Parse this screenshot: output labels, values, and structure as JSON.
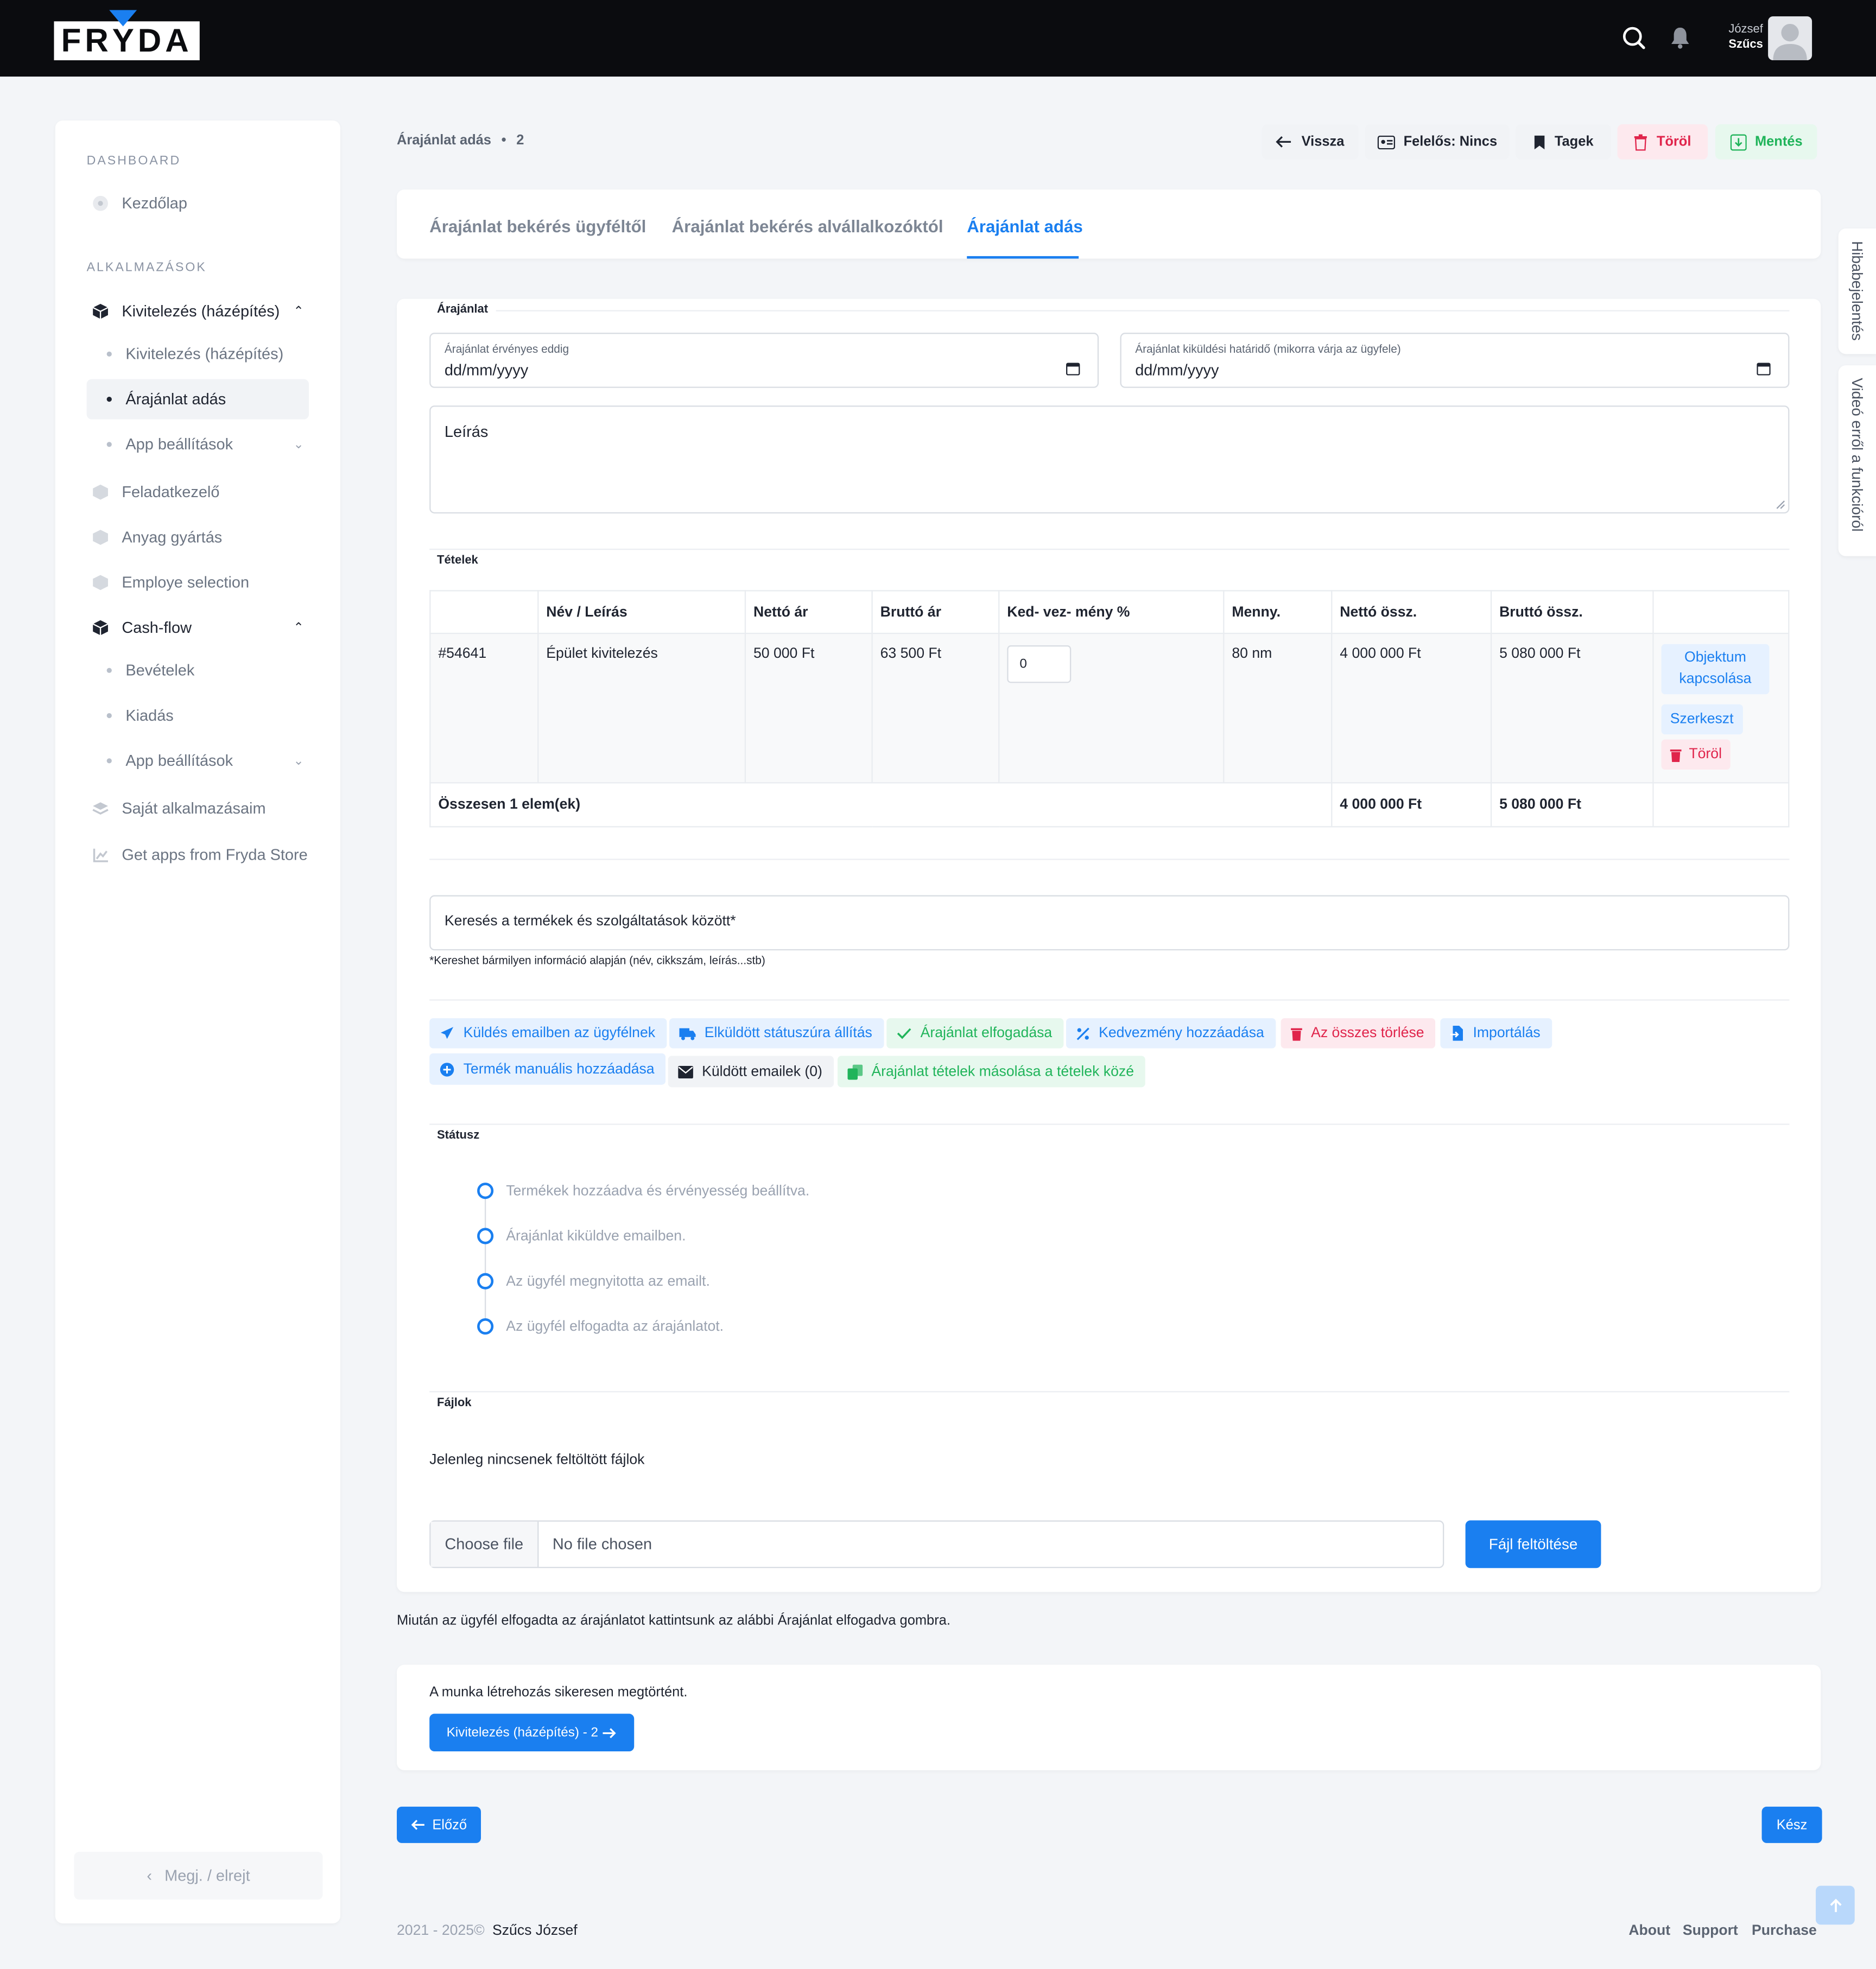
{
  "header": {
    "logo": "FRYDA",
    "user_first": "József",
    "user_last": "Szűcs"
  },
  "sidebar": {
    "dashboard_heading": "DASHBOARD",
    "home": "Kezdőlap",
    "apps_heading": "ALKALMAZÁSOK",
    "group1": "Kivitelezés (házépítés)",
    "group1_items": [
      "Kivitelezés (házépítés)",
      "Árajánlat adás",
      "App beállítások"
    ],
    "task_manager": "Feladatkezelő",
    "material": "Anyag gyártás",
    "employee": "Employe selection",
    "group2": "Cash-flow",
    "group2_items": [
      "Bevételek",
      "Kiadás",
      "App beállítások"
    ],
    "own_apps": "Saját alkalmazásaim",
    "store": "Get apps from Fryda Store",
    "collapse": "Megj. / elrejt"
  },
  "breadcrumb": {
    "title": "Árajánlat adás",
    "sep": "•",
    "id": "2"
  },
  "actions": {
    "back": "Vissza",
    "responsible": "Felelős: Nincs",
    "tags": "Tagek",
    "delete": "Töröl",
    "save": "Mentés"
  },
  "tabs": [
    "Árajánlat bekérés ügyféltől",
    "Árajánlat bekérés alvállalkozóktól",
    "Árajánlat adás"
  ],
  "offer": {
    "section": "Árajánlat",
    "valid_label": "Árajánlat érvényes eddig",
    "valid_value": "dd/mm/yyyy",
    "deadline_label": "Árajánlat kiküldési határidő (mikorra várja az ügyfele)",
    "deadline_value": "dd/mm/yyyy",
    "description_placeholder": "Leírás"
  },
  "items": {
    "section": "Tételek",
    "columns": [
      "",
      "Név / Leírás",
      "Nettó ár",
      "Bruttó ár",
      "Ked- vez- mény %",
      "Menny.",
      "Nettó össz.",
      "Bruttó össz.",
      ""
    ],
    "rows": [
      {
        "id": "#54641",
        "name": "Épület kivitelezés",
        "net": "50 000 Ft",
        "gross": "63 500 Ft",
        "discount": "0",
        "qty": "80 nm",
        "net_total": "4 000 000 Ft",
        "gross_total": "5 080 000 Ft"
      }
    ],
    "row_actions": {
      "link": "Objektum kapcsolása",
      "edit": "Szerkeszt",
      "delete": "Töröl"
    },
    "total_label": "Összesen 1 elem(ek)",
    "total_net": "4 000 000 Ft",
    "total_gross": "5 080 000 Ft"
  },
  "search": {
    "placeholder": "Keresés a termékek és szolgáltatások között*",
    "hint": "*Kereshet bármilyen információ alapján (név, cikkszám, leírás...stb)"
  },
  "tools": {
    "send_email": "Küldés emailben az ügyfélnek",
    "mark_sent": "Elküldött státuszúra állítás",
    "accept": "Árajánlat elfogadása",
    "add_discount": "Kedvezmény hozzáadása",
    "delete_all": "Az összes törlése",
    "import": "Importálás",
    "add_manual": "Termék manuális hozzáadása",
    "sent_emails": "Küldött emailek (0)",
    "copy_items": "Árajánlat tételek másolása a tételek közé"
  },
  "status": {
    "section": "Státusz",
    "steps": [
      "Termékek hozzáadva és érvényesség beállítva.",
      "Árajánlat kiküldve emailben.",
      "Az ügyfél megnyitotta az emailt.",
      "Az ügyfél elfogadta az árajánlatot."
    ]
  },
  "files": {
    "section": "Fájlok",
    "empty": "Jelenleg nincsenek feltöltött fájlok",
    "choose": "Choose file",
    "none": "No file chosen",
    "upload": "Fájl feltöltése"
  },
  "note": "Miután az ügyfél elfogadta az árajánlatot kattintsunk az alábbi Árajánlat elfogadva gombra.",
  "work": {
    "message": "A munka létrehozás sikeresen megtörtént.",
    "button": "Kivitelezés (házépítés) - 2"
  },
  "nav": {
    "prev": "Előző",
    "done": "Kész"
  },
  "side_tabs": {
    "bug": "Hibabejelentés",
    "video": "Videó erről a funkcióról"
  },
  "footer": {
    "years": "2021 - 2025©",
    "author": "Szűcs József",
    "links": [
      "About",
      "Support",
      "Purchase"
    ]
  },
  "colors": {
    "primary": "#1a7ff0",
    "success": "#20b45a",
    "danger": "#e0244b",
    "header_bg": "#0b0c0f"
  }
}
